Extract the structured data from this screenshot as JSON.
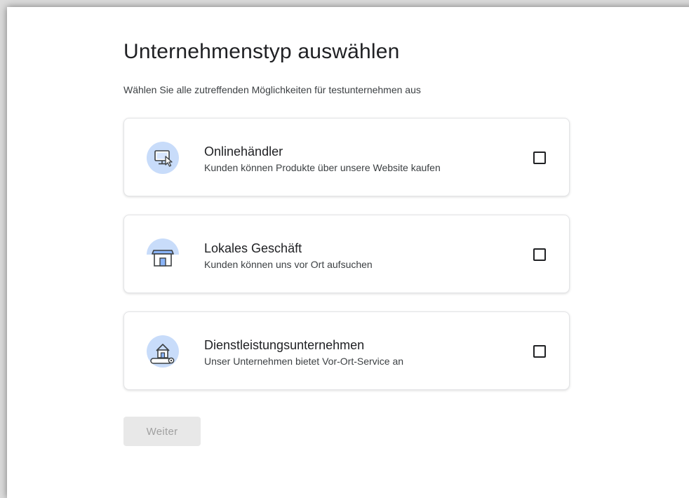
{
  "page": {
    "title": "Unternehmenstyp auswählen",
    "subtitle": "Wählen Sie alle zutreffenden Möglichkeiten für testunternehmen aus"
  },
  "options": [
    {
      "title": "Onlinehändler",
      "description": "Kunden können Produkte über unsere Website kaufen",
      "icon": "monitor-cursor-icon",
      "checked": false
    },
    {
      "title": "Lokales Geschäft",
      "description": "Kunden können uns vor Ort aufsuchen",
      "icon": "storefront-icon",
      "checked": false
    },
    {
      "title": "Dienstleistungsunternehmen",
      "description": "Unser Unternehmen bietet Vor-Ort-Service an",
      "icon": "home-service-icon",
      "checked": false
    }
  ],
  "actions": {
    "next_label": "Weiter",
    "next_enabled": false
  },
  "colors": {
    "icon_bg": "#c8dcfa",
    "icon_stroke": "#3c4043",
    "icon_accent": "#8ab4f8",
    "button_disabled_bg": "#e8e8e8",
    "button_disabled_text": "#a0a0a0"
  }
}
